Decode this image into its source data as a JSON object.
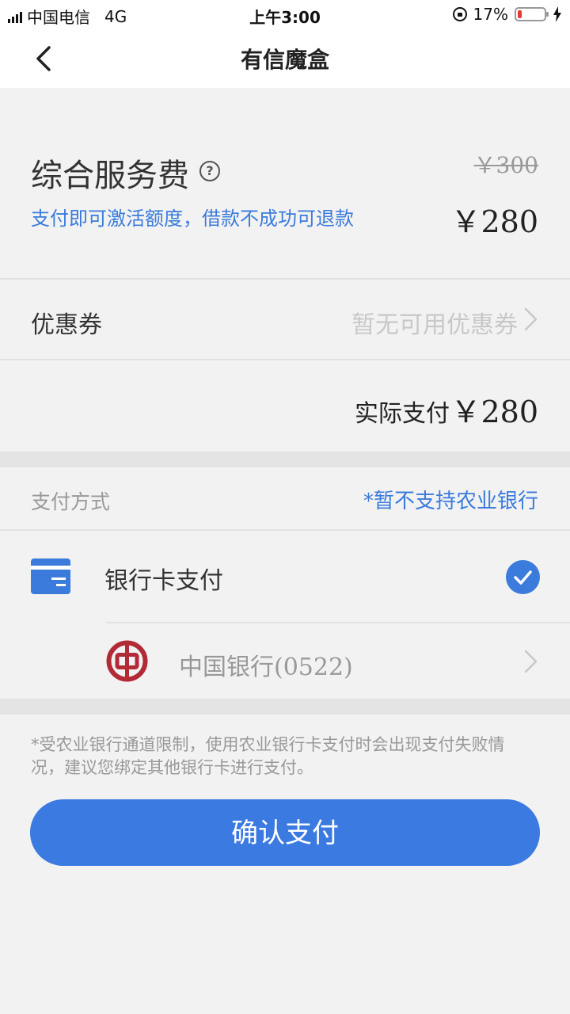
{
  "status_bar": {
    "carrier": "中国电信",
    "network": "4G",
    "time": "上午3:00",
    "battery": "17%",
    "battery_level": 0.17,
    "colors": {
      "battery_low": "#e53935"
    }
  },
  "nav": {
    "title": "有信魔盒",
    "back_icon": "chevron-left-icon"
  },
  "fee": {
    "title": "综合服务费",
    "help_icon": "?",
    "original_price": "￥300",
    "subtitle": "支付即可激活额度，借款不成功可退款",
    "price": "￥280"
  },
  "coupon": {
    "label": "优惠券",
    "value": "暂无可用优惠券"
  },
  "actual": {
    "label": "实际支付",
    "amount": "￥280"
  },
  "payment": {
    "section_label": "支付方式",
    "note": "*暂不支持农业银行",
    "method_label": "银行卡支付",
    "method_selected": true,
    "bank_name": "中国银行",
    "bank_suffix": "(0522)"
  },
  "warning": "*受农业银行通道限制，使用农业银行卡支付时会出现支付失败情况，建议您绑定其他银行卡进行支付。",
  "confirm_label": "确认支付",
  "colors": {
    "accent": "#3b7ae0",
    "link_blue": "#3a7bdc",
    "bank_red": "#b22a36"
  }
}
